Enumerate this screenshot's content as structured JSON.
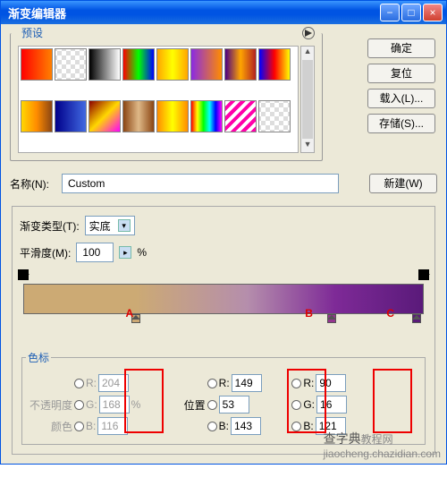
{
  "title": "渐变编辑器",
  "window_buttons": {
    "min": "−",
    "max": "□",
    "close": "×"
  },
  "buttons": {
    "ok": "确定",
    "reset": "复位",
    "load": "载入(L)...",
    "save": "存储(S)..."
  },
  "presets_label": "预设",
  "name_label": "名称(N):",
  "name_value": "Custom",
  "new_btn": "新建(W)",
  "gradient_type_label": "渐变类型(T):",
  "gradient_type_value": "实底",
  "smoothness_label": "平滑度(M):",
  "smoothness_value": "100",
  "percent": "%",
  "stops_label": "色标",
  "labels": {
    "opacity": "不透明度",
    "location": "位置",
    "color": "颜色"
  },
  "rgb": {
    "r": "R:",
    "g": "G:",
    "b": "B:"
  },
  "letters": {
    "a": "A",
    "b": "B",
    "c": "C"
  },
  "stopA": {
    "r": "204",
    "g": "168",
    "b": "116"
  },
  "stopB": {
    "r": "149",
    "g": "53",
    "b": "143"
  },
  "stopC": {
    "r": "90",
    "g": "16",
    "b": "121"
  },
  "watermark": {
    "main": "查字典",
    "sub": "教程网",
    "url": "jiaocheng.chazidian.com"
  },
  "swatch_styles": [
    "linear-gradient(to right,#ff0000,#ff8000)",
    "repeating-conic-gradient(#fff 0 25%,#ddd 0 50%) 50%/10px 10px",
    "linear-gradient(to right,#000,#fff)",
    "linear-gradient(to right,#ff0000,#00ff00,#0000ff)",
    "linear-gradient(to right,#ffa500,#ffff00,#ffa500)",
    "linear-gradient(to right,#8a2be2,#ff8c00)",
    "linear-gradient(to right,#4b0082,#ffa500,#b22222)",
    "linear-gradient(to right,#0000ff,#ff0000,#ffff00)",
    "linear-gradient(to right,#ffd700,#ff8c00,#8b4513)",
    "linear-gradient(to right,#00008b,#4169e1)",
    "linear-gradient(135deg,#8b0000,#ffd700,#ff00ff)",
    "linear-gradient(to right,#8b4513,#deb887,#8b4513)",
    "linear-gradient(to right,#ff8c00,#ffff00,#ff8c00)",
    "linear-gradient(to right,#ff0000,#ffff00,#00ff00,#00ffff,#0000ff,#ff00ff)",
    "repeating-linear-gradient(135deg,#fff 0 4px,#f0a 4px 8px)",
    "repeating-conic-gradient(#fff 0 25%,#ddd 0 50%) 50%/10px 10px"
  ]
}
